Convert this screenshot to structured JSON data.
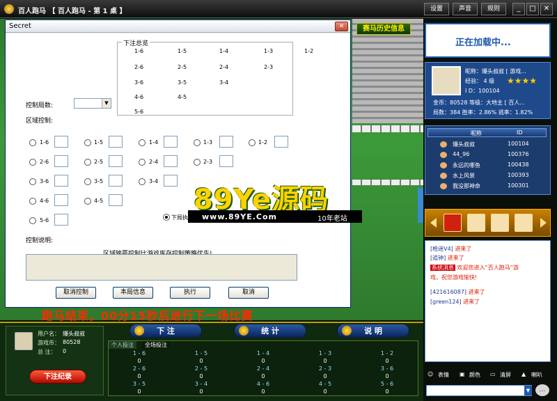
{
  "window": {
    "title": "百人跑马 【 百人跑马 - 第 1 桌 】",
    "buttons": {
      "settings": "设置",
      "sound": "声音",
      "rules": "规则"
    }
  },
  "scene": {
    "history_button": "赛马历史信息",
    "race_status": "跑马结束，00分15秒后进行下一场比赛"
  },
  "dialog": {
    "title": "Secret",
    "overview": {
      "title": "下注总览",
      "rows": [
        [
          "1-6",
          "1-5",
          "1-4",
          "1-3",
          "1-2"
        ],
        [
          "2-6",
          "2-5",
          "2-4",
          "2-3"
        ],
        [
          "3-6",
          "3-5",
          "3-4"
        ],
        [
          "4-6",
          "4-5"
        ],
        [
          "5-6"
        ]
      ]
    },
    "round_label": "控制局数:",
    "area_label": "区域控制:",
    "radio_rows": [
      [
        "1-6",
        "1-5",
        "1-4",
        "1-3",
        "1-2"
      ],
      [
        "2-6",
        "2-5",
        "2-4",
        "2-3"
      ],
      [
        "3-6",
        "3-5",
        "3-4"
      ],
      [
        "4-6",
        "4-5"
      ],
      [
        "5-6"
      ]
    ],
    "next_round_label": "下局执",
    "desc_label": "控制说明:",
    "desc_text": "区域输赢控制比游戏库存控制策略优先!",
    "buttons": {
      "cancel_control": "取消控制",
      "round_info": "本局信息",
      "execute": "执行",
      "cancel": "取消"
    }
  },
  "watermark": {
    "logo": "89Ye源码",
    "url": "www.89YE.Com",
    "tag": "10年老站"
  },
  "user": {
    "name_label": "用户名：",
    "name": "爆头叔叔",
    "coins_label": "游戏币：",
    "coins": "80528",
    "total_label": "总  注：",
    "total": "0",
    "bet_record": "下注纪录"
  },
  "bottom_tabs": {
    "bet": "下 注",
    "stats": "统 计",
    "help": "说 明"
  },
  "bet_grid": {
    "tabs": [
      "个人投注",
      "全场投注"
    ],
    "rows": [
      {
        "labels": [
          "1 - 6",
          "1 - 5",
          "1 - 4",
          "1 - 3",
          "1 - 2"
        ],
        "values": [
          "0",
          "0",
          "0",
          "0",
          "0"
        ]
      },
      {
        "labels": [
          "2 - 6",
          "2 - 5",
          "2 - 4",
          "2 - 3",
          "3 - 6"
        ],
        "values": [
          "0",
          "0",
          "0",
          "0",
          "0"
        ]
      },
      {
        "labels": [
          "3 - 5",
          "3 - 4",
          "4 - 6",
          "4 - 5",
          "5 - 6"
        ],
        "values": [
          "0",
          "0",
          "0",
          "0",
          "0"
        ]
      }
    ]
  },
  "ad": {
    "text": "正在加载中..."
  },
  "profile": {
    "nick": "昵称：爆头叔叔 [ 游戏...",
    "exp": "经验：  4 级",
    "id": "I D：100104",
    "stars": "★★★★",
    "coins": "金币：80528 等级：大地主 [ 百人...",
    "stats": "局数：384 胜率：2.86% 逃率：1.82%"
  },
  "player_list": {
    "headers": [
      "昵称",
      "ID"
    ],
    "rows": [
      {
        "name": "爆头叔叔",
        "id": "100104"
      },
      {
        "name": "44_96",
        "id": "100376"
      },
      {
        "name": "永远的哪鱼",
        "id": "100438"
      },
      {
        "name": "水上风景",
        "id": "100393"
      },
      {
        "name": "我没那神命",
        "id": "100301"
      }
    ]
  },
  "chat": {
    "lines": [
      {
        "name": "[枪迷V4]",
        "msg": "进来了"
      },
      {
        "name": "[追钟]",
        "msg": "进来了"
      }
    ],
    "system_tag": "系统消息",
    "system_msg1": "欢迎您进入“百人跑马”游",
    "system_msg2": "戏，祝您游戏愉快!",
    "lines2": [
      {
        "name": "[421616087]",
        "msg": "进来了"
      },
      {
        "name": "[green124]",
        "msg": "进来了"
      }
    ]
  },
  "toolbar": {
    "emoji": "表情",
    "color": "颜色",
    "clear": "清屏",
    "speaker": "喇叭"
  }
}
